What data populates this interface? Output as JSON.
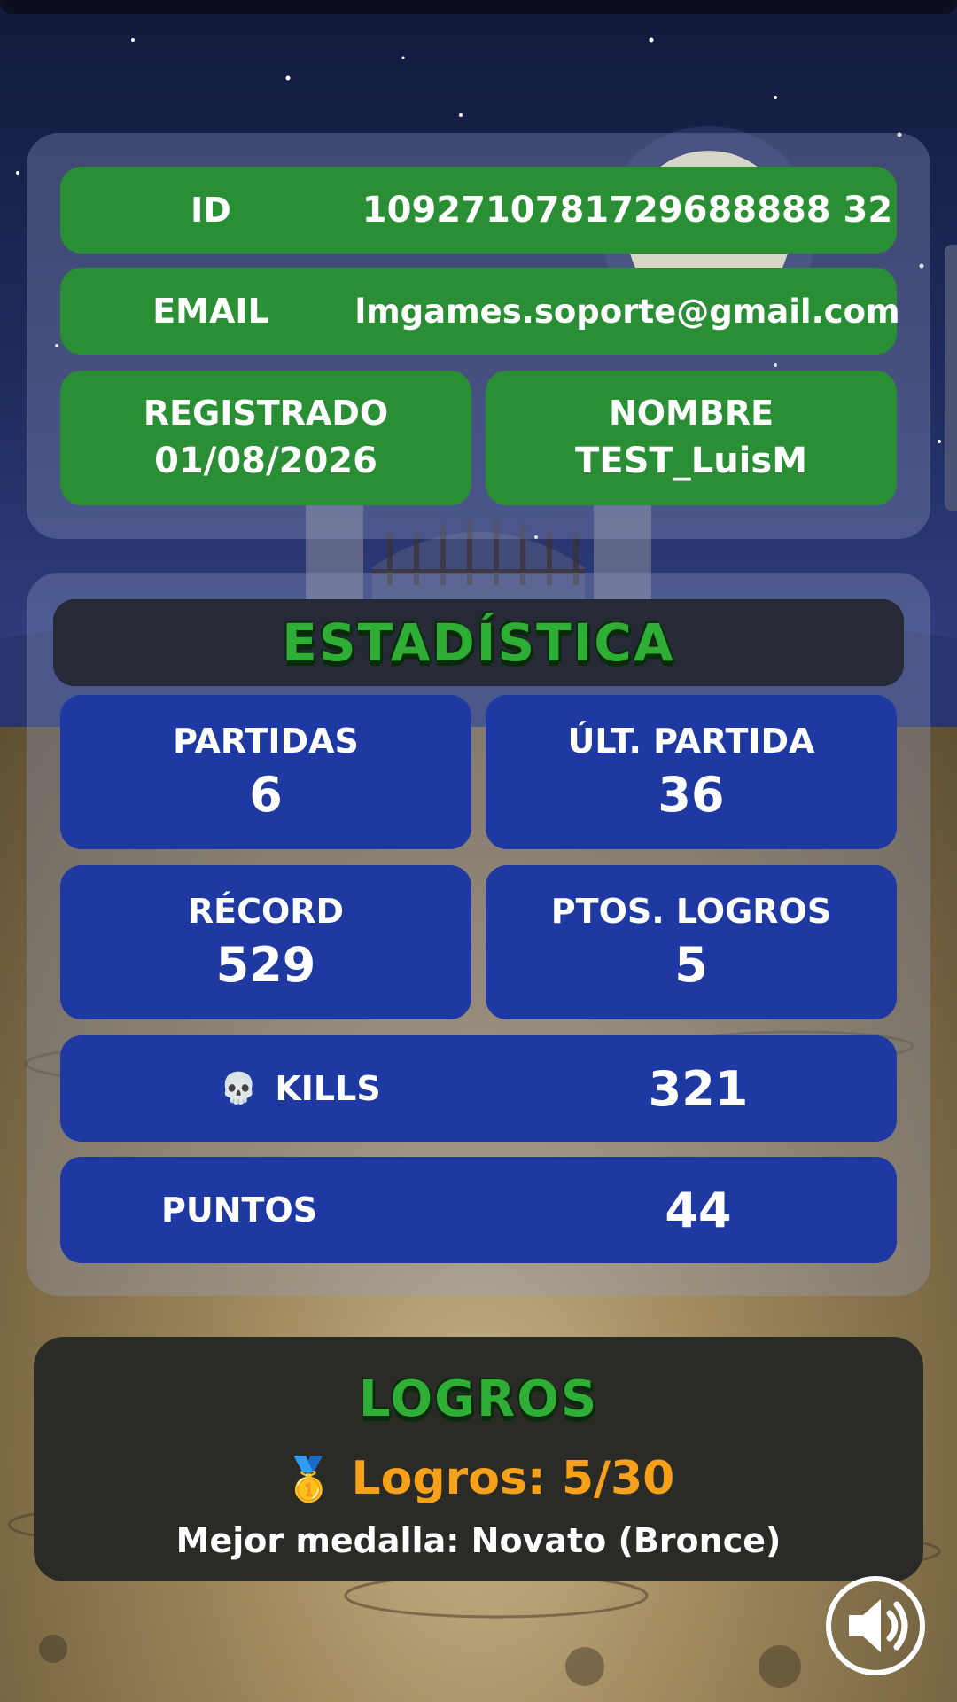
{
  "profile": {
    "id_label": "ID",
    "id_value": "1092710781729688888 32",
    "email_label": "EMAIL",
    "email_value": "lmgames.soporte@gmail.com",
    "registered_label": "REGISTRADO",
    "registered_value": "01/08/2026",
    "name_label": "NOMBRE",
    "name_value": "TEST_LuisM"
  },
  "stats": {
    "title": "ESTADÍSTICA",
    "games_label": "PARTIDAS",
    "games_value": "6",
    "last_game_label": "ÚLT. PARTIDA",
    "last_game_value": "36",
    "record_label": "RÉCORD",
    "record_value": "529",
    "achievement_points_label": "PTOS. LOGROS",
    "achievement_points_value": "5",
    "kills_icon": "💀",
    "kills_label": "KILLS",
    "kills_value": "321",
    "points_label": "PUNTOS",
    "points_value": "44"
  },
  "achievements": {
    "title": "LOGROS",
    "medal_icon": "🥇",
    "count_text": "Logros: 5/30",
    "best_medal_text": "Mejor medalla: Novato (Bronce)"
  },
  "controls": {
    "sound_icon": "speaker-icon"
  },
  "colors": {
    "green": "#2a8e35",
    "blue": "#1e3aa2",
    "title_green": "#2fae36",
    "orange": "#f7a01a"
  }
}
